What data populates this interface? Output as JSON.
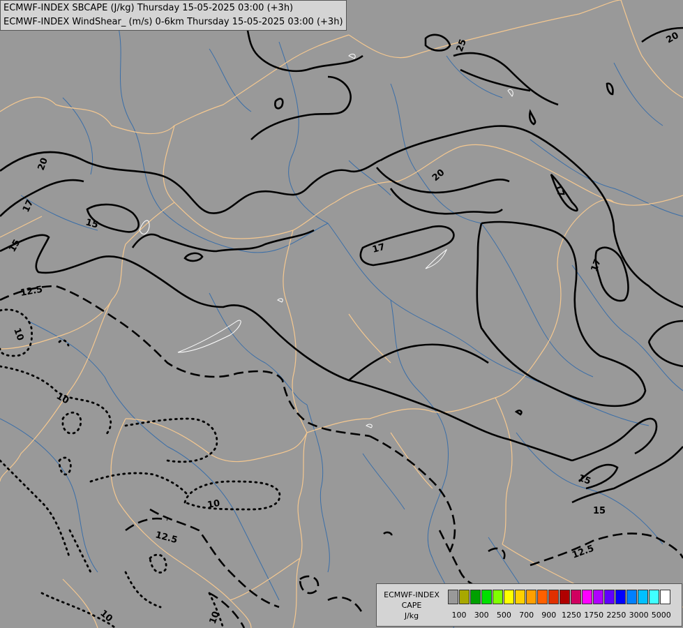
{
  "header": {
    "line1": "ECMWF-INDEX SBCAPE (J/kg) Thursday 15-05-2025 03:00 (+3h)",
    "line2": "ECMWF-INDEX WindShear_ (m/s) 0-6km Thursday 15-05-2025 03:00 (+3h)"
  },
  "legend": {
    "title_line1": "ECMWF-INDEX",
    "title_line2": "CAPE",
    "title_line3": "J/kg",
    "swatch_colors": [
      "#999999",
      "#a8a800",
      "#00a000",
      "#00e000",
      "#80ff00",
      "#ffff00",
      "#ffd000",
      "#ffa000",
      "#ff6000",
      "#e03000",
      "#b00000",
      "#d00060",
      "#ff00ff",
      "#b000ff",
      "#6000ff",
      "#0000ff",
      "#0080ff",
      "#00c0ff",
      "#40ffff",
      "#ffffff"
    ],
    "ticks": [
      "100",
      "300",
      "500",
      "700",
      "900",
      "1250",
      "1750",
      "2250",
      "3000",
      "5000"
    ]
  },
  "map": {
    "background_color": "#999999",
    "border_color": "#f5c890",
    "river_color": "#3a6ea8",
    "contour_labels": [
      "25",
      "20",
      "20",
      "20",
      "17",
      "17",
      "17",
      "17",
      "15",
      "15",
      "15",
      "15",
      "12.5",
      "12.5",
      "12.5",
      "10",
      "10",
      "10",
      "10",
      "10"
    ]
  }
}
